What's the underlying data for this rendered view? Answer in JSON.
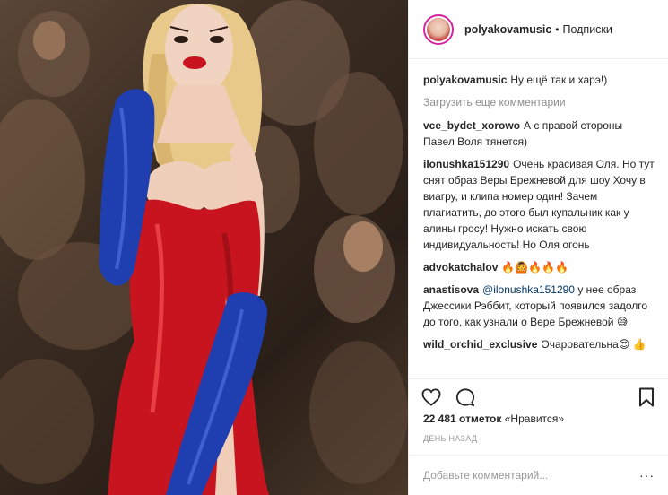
{
  "post": {
    "image_alt": "",
    "author": "polyakovamusic",
    "separator": "•",
    "follow_label": "Подписки"
  },
  "comments": {
    "caption": {
      "user": "polyakovamusic",
      "text": "Ну ещё так и харэ!)"
    },
    "load_more": "Загрузить еще комментарии",
    "items": [
      {
        "user": "vce_bydet_xorowo",
        "text": "А с правой стороны Павел Воля тянется)"
      },
      {
        "user": "ilonushka151290",
        "text": "Очень красивая Оля. Но тут снят образ Веры Брежневой для шоу Хочу в виагру, и клипа номер один! Зачем плагиатить, до этого был купальник как у алины гросу! Нужно искать свою индивидуальность! Но Оля огонь"
      },
      {
        "user": "advokatchalov",
        "text": "🔥🙆🔥🔥🔥"
      },
      {
        "user": "anastisova",
        "mention": "@ilonushka151290",
        "text": "у нее образ Джессики Рэббит, который появился задолго до того, как узнали о Вере Брежневой 😅"
      },
      {
        "user": "wild_orchid_exclusive",
        "text": "Очаровательна😍 👍"
      }
    ]
  },
  "actions": {
    "like_icon": "heart-icon",
    "comment_icon": "comment-icon",
    "save_icon": "bookmark-icon"
  },
  "stats": {
    "likes_count": "22 481 отметок",
    "likes_suffix": "«Нравится»",
    "time": "ДЕНЬ НАЗАД"
  },
  "add_comment": {
    "placeholder": "Добавьте комментарий...",
    "more_label": "···"
  },
  "colors": {
    "dress_red": "#c8141e",
    "glove_blue": "#1f3fb0",
    "hair_blonde": "#e8c98a",
    "background_brown": "#3c2d22"
  }
}
